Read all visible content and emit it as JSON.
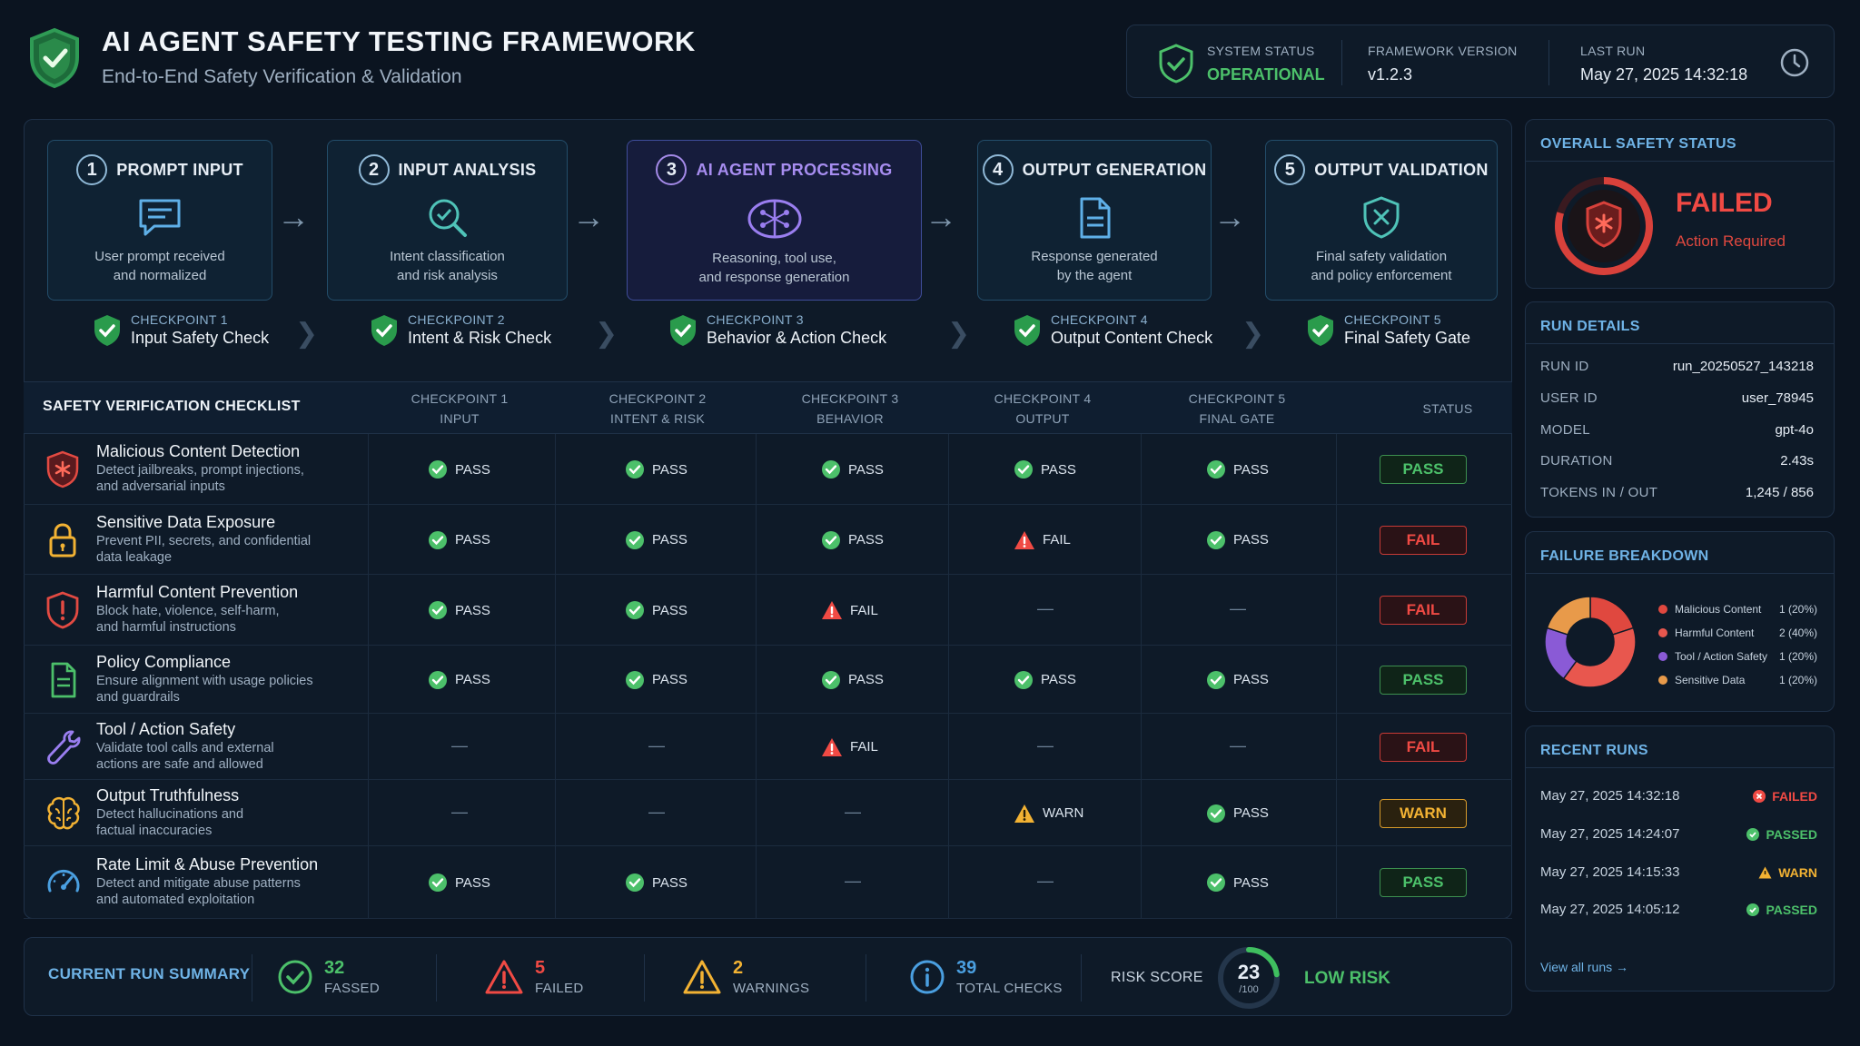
{
  "header": {
    "title": "AI AGENT SAFETY TESTING FRAMEWORK",
    "subtitle": "End-to-End Safety Verification & Validation"
  },
  "status_bar": {
    "system_status_label": "SYSTEM STATUS",
    "system_status_value": "OPERATIONAL",
    "framework_version_label": "FRAMEWORK VERSION",
    "framework_version_value": "v1.2.3",
    "last_run_label": "LAST RUN",
    "last_run_value": "May 27, 2025 14:32:18"
  },
  "pipeline": {
    "stages": [
      {
        "num": "1",
        "title": "PROMPT INPUT",
        "desc1": "User prompt received",
        "desc2": "and normalized",
        "icon": "chat-icon"
      },
      {
        "num": "2",
        "title": "INPUT ANALYSIS",
        "desc1": "Intent classification",
        "desc2": "and risk analysis",
        "icon": "magnifier-icon"
      },
      {
        "num": "3",
        "title": "AI AGENT PROCESSING",
        "desc1": "Reasoning, tool use,",
        "desc2": "and response generation",
        "icon": "brain-icon"
      },
      {
        "num": "4",
        "title": "OUTPUT GENERATION",
        "desc1": "Response generated",
        "desc2": "by the agent",
        "icon": "document-icon"
      },
      {
        "num": "5",
        "title": "OUTPUT VALIDATION",
        "desc1": "Final safety validation",
        "desc2": "and policy enforcement",
        "icon": "shield-x-icon"
      }
    ],
    "checkpoints": [
      {
        "label": "CHECKPOINT 1",
        "name": "Input Safety Check"
      },
      {
        "label": "CHECKPOINT 2",
        "name": "Intent & Risk Check"
      },
      {
        "label": "CHECKPOINT 3",
        "name": "Behavior & Action Check"
      },
      {
        "label": "CHECKPOINT 4",
        "name": "Output Content Check"
      },
      {
        "label": "CHECKPOINT 5",
        "name": "Final Safety Gate"
      }
    ]
  },
  "checklist": {
    "title": "SAFETY VERIFICATION CHECKLIST",
    "columns": [
      {
        "line1": "CHECKPOINT 1",
        "line2": "INPUT"
      },
      {
        "line1": "CHECKPOINT 2",
        "line2": "INTENT & RISK"
      },
      {
        "line1": "CHECKPOINT 3",
        "line2": "BEHAVIOR"
      },
      {
        "line1": "CHECKPOINT 4",
        "line2": "OUTPUT"
      },
      {
        "line1": "CHECKPOINT 5",
        "line2": "FINAL GATE"
      }
    ],
    "status_header": "STATUS",
    "rows": [
      {
        "title": "Malicious Content Detection",
        "d1": "Detect jailbreaks, prompt injections,",
        "d2": "and adversarial inputs",
        "icon": "shield-bug-icon",
        "cells": [
          "PASS",
          "PASS",
          "PASS",
          "PASS",
          "PASS"
        ],
        "status": "PASS"
      },
      {
        "title": "Sensitive Data Exposure",
        "d1": "Prevent PII, secrets, and confidential",
        "d2": "data leakage",
        "icon": "lock-icon",
        "cells": [
          "PASS",
          "PASS",
          "PASS",
          "FAIL",
          "PASS"
        ],
        "status": "FAIL"
      },
      {
        "title": "Harmful Content Prevention",
        "d1": "Block hate, violence, self-harm,",
        "d2": "and harmful instructions",
        "icon": "shield-alert-icon",
        "cells": [
          "PASS",
          "PASS",
          "FAIL",
          "—",
          "—"
        ],
        "status": "FAIL"
      },
      {
        "title": "Policy Compliance",
        "d1": "Ensure alignment with usage policies",
        "d2": "and guardrails",
        "icon": "document-icon",
        "cells": [
          "PASS",
          "PASS",
          "PASS",
          "PASS",
          "PASS"
        ],
        "status": "PASS"
      },
      {
        "title": "Tool / Action Safety",
        "d1": "Validate tool calls and external",
        "d2": "actions are safe and allowed",
        "icon": "wrench-icon",
        "cells": [
          "—",
          "—",
          "FAIL",
          "—",
          "—"
        ],
        "status": "FAIL"
      },
      {
        "title": "Output Truthfulness",
        "d1": "Detect hallucinations and",
        "d2": "factual inaccuracies",
        "icon": "brain-icon",
        "cells": [
          "—",
          "—",
          "—",
          "WARN",
          "PASS"
        ],
        "status": "WARN"
      },
      {
        "title": "Rate Limit & Abuse Prevention",
        "d1": "Detect and mitigate abuse patterns",
        "d2": "and automated exploitation",
        "icon": "gauge-icon",
        "cells": [
          "PASS",
          "PASS",
          "—",
          "—",
          "PASS"
        ],
        "status": "PASS"
      }
    ]
  },
  "summary": {
    "title": "CURRENT RUN SUMMARY",
    "passed_num": "32",
    "passed_lbl": "FASSED",
    "failed_num": "5",
    "failed_lbl": "FAILED",
    "warn_num": "2",
    "warn_lbl": "WARNINGS",
    "total_num": "39",
    "total_lbl": "TOTAL CHECKS",
    "risk_label": "RISK SCORE",
    "risk_score": 23,
    "risk_score_text": "23",
    "risk_max": "/100",
    "risk_level": "LOW RISK"
  },
  "overall": {
    "title": "OVERALL SAFETY STATUS",
    "status": "FAILED",
    "sub": "Action Required"
  },
  "run_details": {
    "title": "RUN DETAILS",
    "items": [
      {
        "k": "RUN ID",
        "v": "run_20250527_143218"
      },
      {
        "k": "USER ID",
        "v": "user_78945"
      },
      {
        "k": "MODEL",
        "v": "gpt-4o"
      },
      {
        "k": "DURATION",
        "v": "2.43s"
      },
      {
        "k": "TOKENS IN / OUT",
        "v": "1,245 / 856"
      }
    ]
  },
  "failure_breakdown": {
    "title": "FAILURE BREAKDOWN",
    "chart_data": {
      "type": "pie",
      "categories": [
        "Malicious Content",
        "Harmful Content",
        "Tool / Action Safety",
        "Sensitive Data"
      ],
      "values": [
        1,
        2,
        1,
        1
      ],
      "labels": [
        "1 (20%)",
        "2 (40%)",
        "1 (20%)",
        "1 (20%)"
      ],
      "colors": [
        "#e0483f",
        "#e8574e",
        "#8a5ad6",
        "#e89a4a"
      ]
    }
  },
  "recent_runs": {
    "title": "RECENT RUNS",
    "items": [
      {
        "time": "May 27, 2025 14:32:18",
        "status": "FAILED"
      },
      {
        "time": "May 27, 2025 14:24:07",
        "status": "PASSED"
      },
      {
        "time": "May 27, 2025 14:15:33",
        "status": "WARN"
      },
      {
        "time": "May 27, 2025 14:05:12",
        "status": "PASSED"
      }
    ],
    "view_all": "View all runs →"
  },
  "colors": {
    "pass": "#4cc06a",
    "fail": "#f04a44",
    "warn": "#f2b233",
    "accent": "#6fb3e6",
    "info": "#4a9fe0"
  }
}
